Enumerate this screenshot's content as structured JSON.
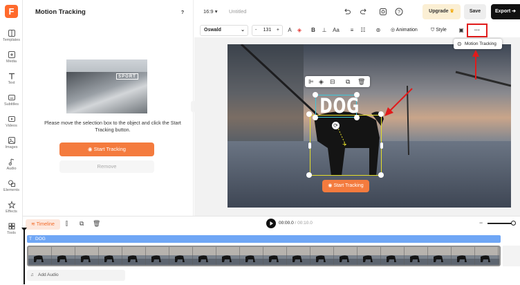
{
  "app": {
    "logo_letter": "F",
    "project_title": "Untitled",
    "aspect_ratio": "16:9"
  },
  "sidebar": {
    "items": [
      {
        "label": "Templates",
        "icon": "templates-icon"
      },
      {
        "label": "Media",
        "icon": "media-icon"
      },
      {
        "label": "Text",
        "icon": "text-icon"
      },
      {
        "label": "Subtitles",
        "icon": "subtitles-icon"
      },
      {
        "label": "Videos",
        "icon": "videos-icon"
      },
      {
        "label": "Images",
        "icon": "images-icon"
      },
      {
        "label": "Audio",
        "icon": "audio-icon"
      },
      {
        "label": "Elements",
        "icon": "elements-icon"
      },
      {
        "label": "Effects",
        "icon": "effects-icon"
      },
      {
        "label": "Tools",
        "icon": "tools-icon"
      }
    ]
  },
  "panel": {
    "title": "Motion Tracking",
    "help": "?",
    "thumb_text": "SPORT",
    "instruction": "Please move the selection box to the object and click the Start Tracking button.",
    "start_button": "Start Tracking",
    "remove_button": "Remove"
  },
  "topbar": {
    "upgrade_label": "Upgrade",
    "save_label": "Save",
    "export_label": "Export"
  },
  "format_toolbar": {
    "font": "Oswald",
    "font_size": "131",
    "minus": "-",
    "plus": "+",
    "bold": "B",
    "case": "Aa",
    "animation_label": "Animation",
    "style_label": "Style",
    "more": "···"
  },
  "popup": {
    "motion_tracking_label": "Motion Tracking"
  },
  "canvas": {
    "text_element": "DOG",
    "start_tracking_label": "Start Tracking"
  },
  "timeline": {
    "tab_label": "Timeline",
    "current_time": "00:00.0",
    "total_time": "00:10.0",
    "text_track_label": "DOG",
    "add_audio_label": "Add Audio"
  },
  "colors": {
    "accent_orange": "#f47b3e",
    "highlight_red": "#e11b1b",
    "selection_yellow": "#e6e02a",
    "selection_cyan": "#3fc6d9"
  }
}
